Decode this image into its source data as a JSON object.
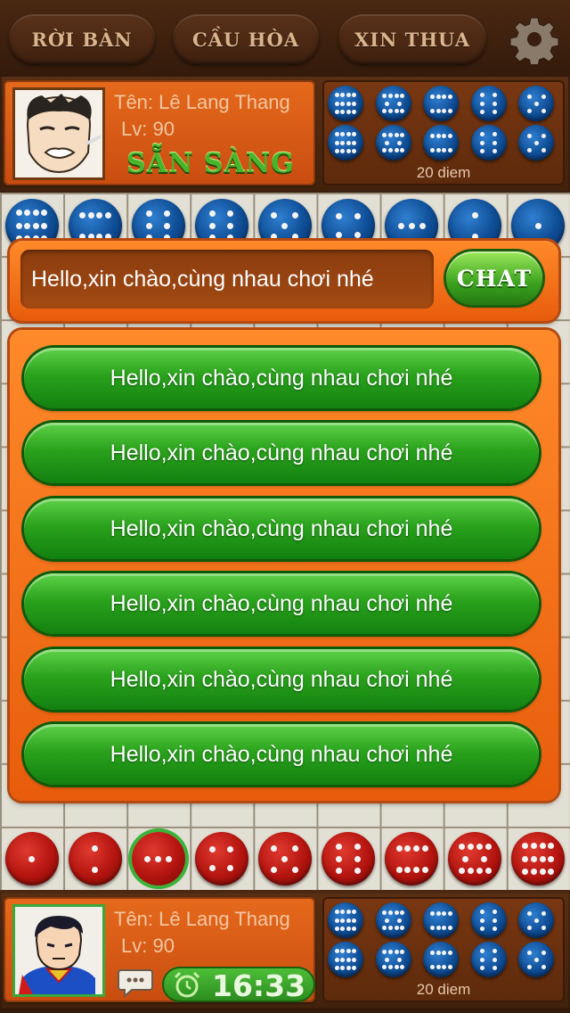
{
  "top_menu": {
    "leave_table": "RỜI BÀN",
    "offer_draw": "CẦU HÒA",
    "resign": "XIN THUA",
    "settings_icon": "gear-icon"
  },
  "opponent": {
    "name": "Tên: Lê Lang Thang",
    "level": "Lv: 90",
    "status": "SẴN SÀNG",
    "score": "20 diem"
  },
  "player": {
    "name": "Tên: Lê Lang Thang",
    "level": "Lv: 90",
    "timer": "16:33",
    "score": "20 diem"
  },
  "chat": {
    "input_value": "Hello,xin chào,cùng nhau chơi nhé",
    "send_label": "CHAT",
    "quick_messages": [
      "Hello,xin chào,cùng nhau chơi nhé",
      "Hello,xin chào,cùng nhau chơi nhé",
      "Hello,xin chào,cùng nhau chơi nhé",
      "Hello,xin chào,cùng nhau chơi nhé",
      "Hello,xin chào,cùng nhau chơi nhé",
      "Hello,xin chào,cùng nhau chơi nhé"
    ]
  },
  "board": {
    "blue_row_pips": [
      12,
      8,
      6,
      6,
      5,
      4,
      3,
      2,
      1
    ],
    "red_row_pips": [
      1,
      2,
      3,
      4,
      5,
      6,
      8,
      10,
      12
    ],
    "selected_red_index": 2,
    "opponent_captured_pips": [
      12,
      10,
      8,
      6,
      5,
      12,
      10,
      8,
      6,
      5
    ],
    "player_captured_pips": [
      12,
      10,
      8,
      6,
      5,
      12,
      10,
      8,
      6,
      5
    ]
  },
  "colors": {
    "panel_orange": "#e85c0c",
    "button_green": "#2aa21c",
    "piece_blue": "#0e4c93",
    "piece_red": "#b3140f"
  }
}
